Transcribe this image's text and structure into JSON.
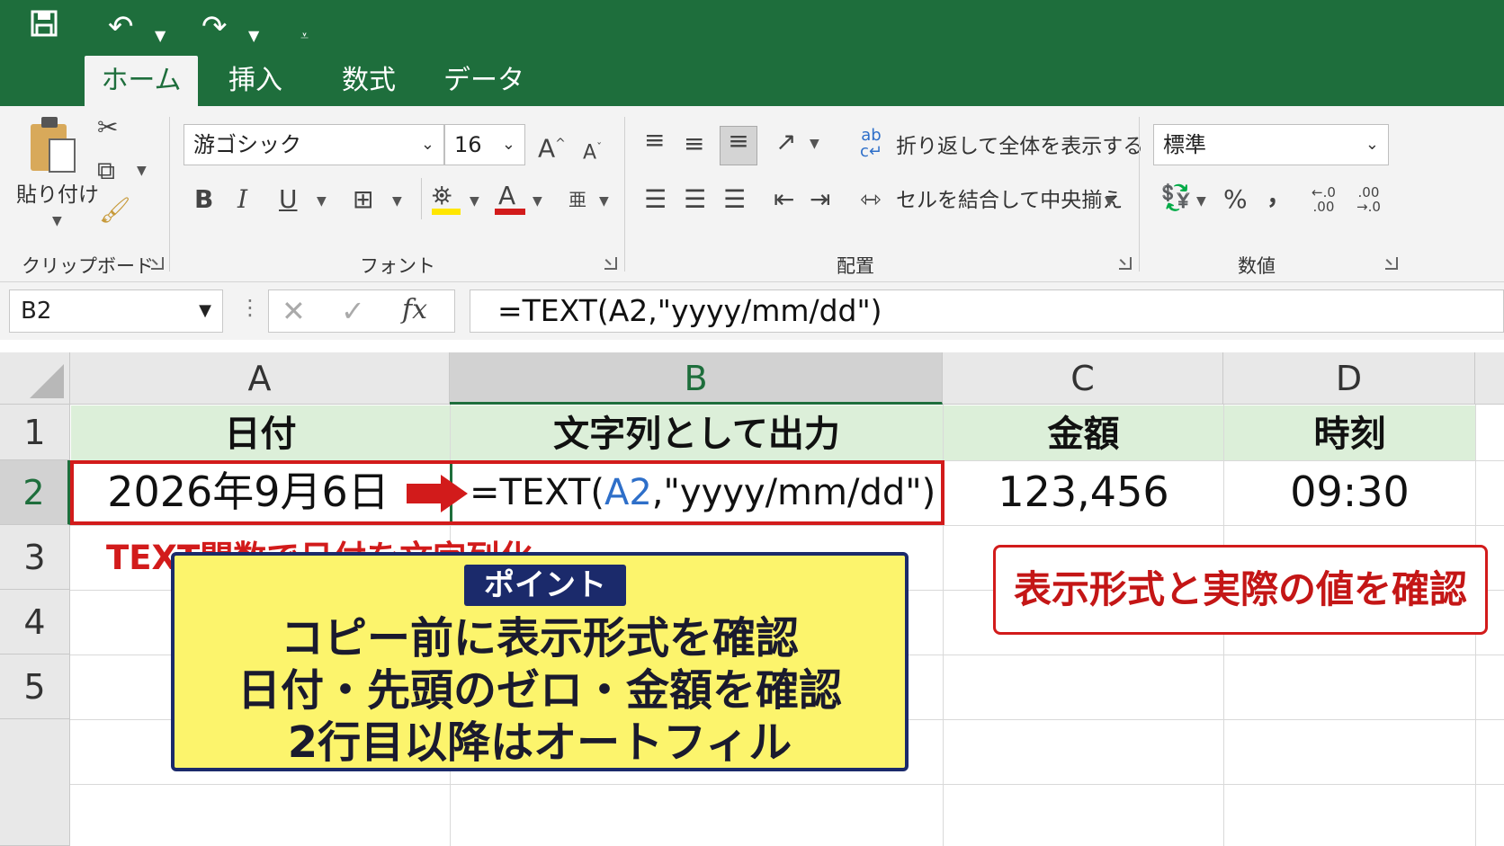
{
  "qat": {
    "save_icon": "save-icon",
    "undo_icon": "undo-icon",
    "redo_icon": "redo-icon",
    "customize_icon": "customize-icon"
  },
  "tabs": [
    {
      "label": "ホーム",
      "active": true
    },
    {
      "label": "挿入"
    },
    {
      "label": "数式"
    },
    {
      "label": "データ"
    }
  ],
  "ribbon": {
    "clipboard": {
      "paste_label": "貼り付け",
      "group_label": "クリップボード"
    },
    "font": {
      "font_name": "游ゴシック",
      "font_size": "16",
      "bold": "B",
      "italic": "I",
      "underline": "U",
      "font_color_glyph": "A",
      "group_label": "フォント"
    },
    "alignment": {
      "wrap_text": "折り返して全体を表示する",
      "merge_center": "セルを結合して中央揃え",
      "group_label": "配置"
    },
    "number": {
      "format": "標準",
      "percent": "%",
      "comma": "，",
      "group_label": "数値"
    }
  },
  "formula_bar": {
    "name_box": "B2",
    "fx": "fx",
    "formula": "=TEXT(A2,\"yyyy/mm/dd\")"
  },
  "columns": [
    "A",
    "B",
    "C",
    "D"
  ],
  "rows": [
    "1",
    "2",
    "3",
    "4",
    "5"
  ],
  "headers": {
    "a": "日付",
    "b": "文字列として出力",
    "c": "金額",
    "d": "時刻"
  },
  "row2": {
    "a": "2026年9月6日",
    "b_prefix": "=TEXT(",
    "b_ref": "A2",
    "b_suffix": ",\"yyyy/mm/dd\")",
    "c": "123,456",
    "d": "09:30"
  },
  "annotations": {
    "note": "TEXT関数で日付を文字列化",
    "callout": "表示形式と実際の値を確認",
    "point_tag": "ポイント",
    "point_lines": [
      "コピー前に表示形式を確認",
      "日付・先頭のゼロ・金額を確認",
      "2行目以降はオートフィル"
    ]
  },
  "colors": {
    "excel_green": "#1e6e3c",
    "highlight_red": "#d21b1b",
    "point_yellow": "#fcf46c",
    "point_navy": "#1b2a6b",
    "ref_blue": "#2e6fc9"
  }
}
